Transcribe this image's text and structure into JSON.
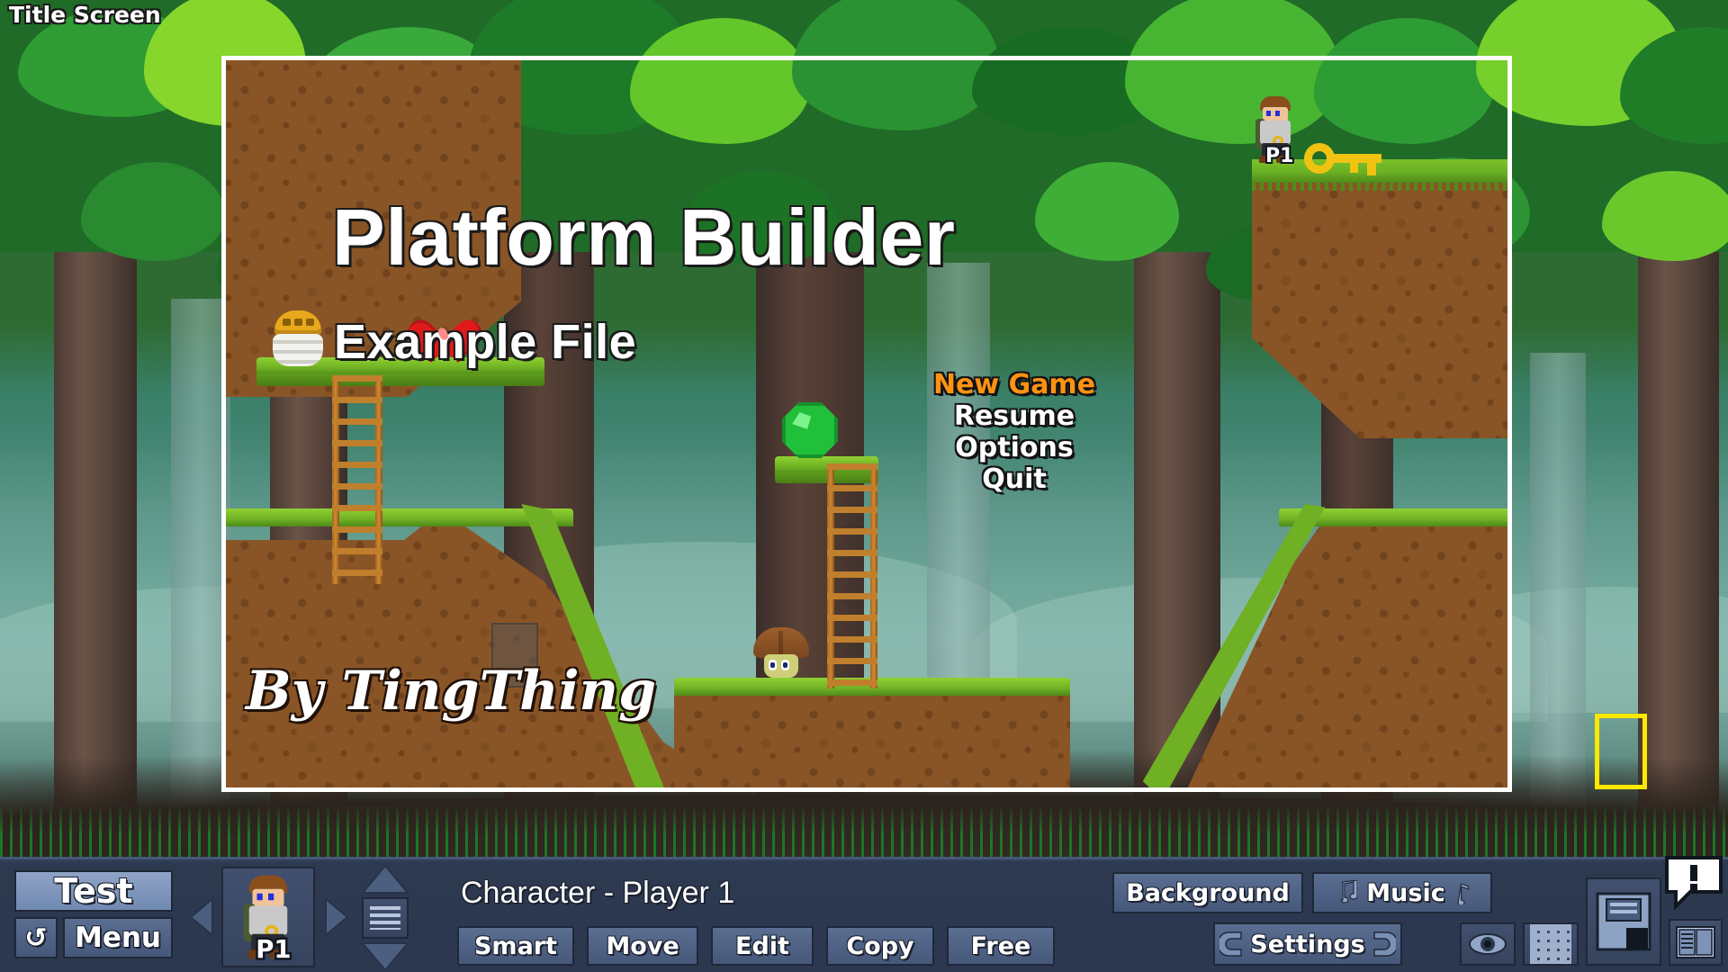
{
  "scene": {
    "label": "Title Screen"
  },
  "title_screen": {
    "title": "Platform Builder",
    "subtitle": "Example File",
    "byline": "By TingThing",
    "menu": [
      {
        "label": "New Game",
        "selected": true
      },
      {
        "label": "Resume",
        "selected": false
      },
      {
        "label": "Options",
        "selected": false
      },
      {
        "label": "Quit",
        "selected": false
      }
    ]
  },
  "level": {
    "player_tag": "P1",
    "entities": [
      {
        "name": "player-1-sprite",
        "tag": "P1"
      },
      {
        "name": "key-pickup"
      },
      {
        "name": "heart-pickup"
      },
      {
        "name": "beehive-pickup"
      },
      {
        "name": "emerald-gem-pickup"
      },
      {
        "name": "mushroom-enemy"
      }
    ]
  },
  "toolbar": {
    "test_label": "Test",
    "undo_label": "↺",
    "menu_label": "Menu",
    "prev_label": "◀",
    "next_label": "▶",
    "character_thumb_tag": "P1",
    "list_icon": "list-icon",
    "up_icon": "chevron-up-icon",
    "down_icon": "chevron-down-icon",
    "status_title": "Character - Player 1",
    "modes": [
      {
        "label": "Smart",
        "active": false
      },
      {
        "label": "Move",
        "active": false
      },
      {
        "label": "Edit",
        "active": false
      },
      {
        "label": "Copy",
        "active": false
      },
      {
        "label": "Free",
        "active": false
      }
    ],
    "background_label": "Background",
    "music_label": "Music",
    "settings_label": "Settings",
    "eye_icon": "eye-icon",
    "grid_icon": "grid-icon",
    "save_icon": "floppy-disk-save-icon",
    "book_icon": "book-manual-icon",
    "alert_icon": "speech-bubble-alert-icon"
  },
  "colors": {
    "accent_selected": "#ff9212",
    "toolbar_bg": "#2b3850",
    "button_face": "#5a6e91",
    "button_border": "#1f2738",
    "selection_box": "#ffe800",
    "frame_border": "#ffffff",
    "dirt": "#8a5526",
    "grass": "#6fb024"
  }
}
